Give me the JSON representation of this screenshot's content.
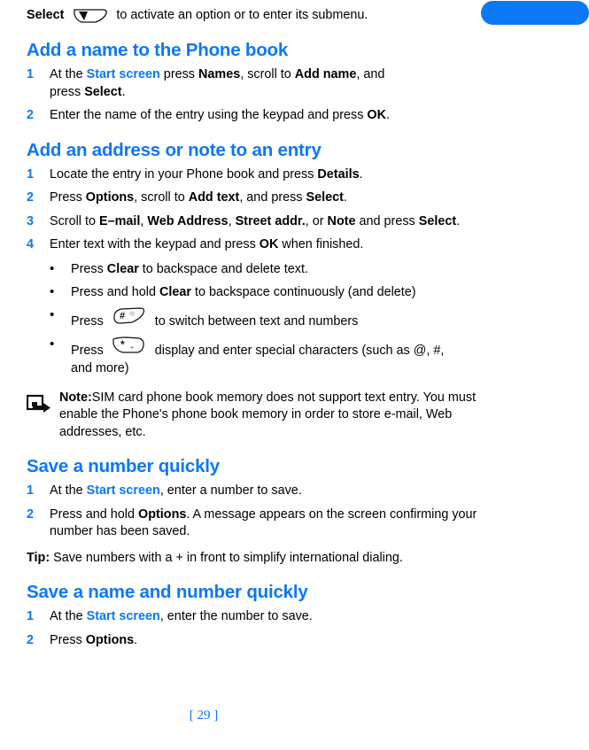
{
  "page": {
    "number_label": "[ 29 ]",
    "accent_color": "#0b78f5",
    "text_color": "#000000",
    "background_color": "#ffffff"
  },
  "tab_marker": {
    "name": "chapter-tab-marker",
    "color": "#0b78f5"
  },
  "intro": {
    "before_icon": "Select ",
    "icon": "select-soft-key-icon",
    "after_icon": " to activate an option or to enter its submenu."
  },
  "sections": [
    {
      "heading": "Add a name to the Phone book",
      "steps": [
        {
          "number": "1",
          "parts": [
            {
              "text": "At the ",
              "style": "normal"
            },
            {
              "text": "Start screen",
              "style": "bluebold"
            },
            {
              "text": " press ",
              "style": "normal"
            },
            {
              "text": "Names",
              "style": "bold"
            },
            {
              "text": ", scroll to ",
              "style": "normal"
            },
            {
              "text": "Add name",
              "style": "bold"
            },
            {
              "text": ", and",
              "style": "normal"
            },
            {
              "text": "BREAK",
              "style": "break"
            },
            {
              "text": "press ",
              "style": "normal"
            },
            {
              "text": "Select",
              "style": "bold"
            },
            {
              "text": ".",
              "style": "normal"
            }
          ]
        },
        {
          "number": "2",
          "parts": [
            {
              "text": "Enter the name of the entry using the keypad and press ",
              "style": "normal"
            },
            {
              "text": "OK",
              "style": "bold"
            },
            {
              "text": ".",
              "style": "normal"
            }
          ]
        }
      ]
    },
    {
      "heading": "Add an address or note to an entry",
      "steps": [
        {
          "number": "1",
          "parts": [
            {
              "text": "Locate the entry in your Phone book and press ",
              "style": "normal"
            },
            {
              "text": "Details",
              "style": "bold"
            },
            {
              "text": ".",
              "style": "normal"
            }
          ]
        },
        {
          "number": "2",
          "parts": [
            {
              "text": "Press ",
              "style": "normal"
            },
            {
              "text": "Options",
              "style": "bold"
            },
            {
              "text": ", scroll to ",
              "style": "normal"
            },
            {
              "text": "Add text",
              "style": "bold"
            },
            {
              "text": ", and press ",
              "style": "normal"
            },
            {
              "text": "Select",
              "style": "bold"
            },
            {
              "text": ".",
              "style": "normal"
            }
          ]
        },
        {
          "number": "3",
          "parts": [
            {
              "text": "Scroll to ",
              "style": "normal"
            },
            {
              "text": "E–mail",
              "style": "bold"
            },
            {
              "text": ", ",
              "style": "normal"
            },
            {
              "text": "Web Address",
              "style": "bold"
            },
            {
              "text": ", ",
              "style": "normal"
            },
            {
              "text": "Street addr.",
              "style": "bold"
            },
            {
              "text": ", or ",
              "style": "normal"
            },
            {
              "text": "Note",
              "style": "bold"
            },
            {
              "text": " and press ",
              "style": "normal"
            },
            {
              "text": "Select",
              "style": "bold"
            },
            {
              "text": ".",
              "style": "normal"
            }
          ]
        },
        {
          "number": "4",
          "parts": [
            {
              "text": "Enter text with the keypad and press ",
              "style": "normal"
            },
            {
              "text": "OK",
              "style": "bold"
            },
            {
              "text": " when finished.",
              "style": "normal"
            }
          ]
        }
      ],
      "bullets": [
        {
          "marker": "•",
          "parts": [
            {
              "text": "Press ",
              "style": "normal"
            },
            {
              "text": "Clear",
              "style": "bold"
            },
            {
              "text": " to backspace and delete text.",
              "style": "normal"
            }
          ]
        },
        {
          "marker": "•",
          "parts": [
            {
              "text": "Press and hold ",
              "style": "normal"
            },
            {
              "text": "Clear",
              "style": "bold"
            },
            {
              "text": " to backspace continuously (and delete)",
              "style": "normal"
            }
          ]
        },
        {
          "marker": "•",
          "parts": [
            {
              "text": "Press ",
              "style": "normal"
            },
            {
              "text": "hash-key-icon",
              "style": "icon-hash"
            },
            {
              "text": " to switch between text and numbers",
              "style": "normal"
            }
          ]
        },
        {
          "marker": "•",
          "parts": [
            {
              "text": "Press ",
              "style": "normal"
            },
            {
              "text": "star-key-icon",
              "style": "icon-star"
            },
            {
              "text": " display and enter special characters (such as @, #,",
              "style": "normal"
            },
            {
              "text": "BREAK",
              "style": "break"
            },
            {
              "text": "and more)",
              "style": "normal"
            }
          ]
        }
      ],
      "note": {
        "icon": "note-pointer-icon",
        "label": "Note:",
        "text": "SIM card phone book memory does not support text entry. You must enable the Phone's phone book memory in order to store e-mail, Web addresses, etc."
      }
    },
    {
      "heading": "Save a number quickly",
      "steps": [
        {
          "number": "1",
          "parts": [
            {
              "text": "At the ",
              "style": "normal"
            },
            {
              "text": "Start screen",
              "style": "bluebold"
            },
            {
              "text": ", enter a number to save.",
              "style": "normal"
            }
          ]
        },
        {
          "number": "2",
          "parts": [
            {
              "text": "Press and hold ",
              "style": "normal"
            },
            {
              "text": "Options",
              "style": "bold"
            },
            {
              "text": ". A message appears on the screen confirming your number has been saved.",
              "style": "normal"
            }
          ]
        }
      ],
      "tip": {
        "label": "Tip:",
        "text": "  Save numbers with a + in front to simplify international dialing."
      }
    },
    {
      "heading": "Save a name and number quickly",
      "steps": [
        {
          "number": "1",
          "parts": [
            {
              "text": "At the ",
              "style": "normal"
            },
            {
              "text": "Start screen",
              "style": "bluebold"
            },
            {
              "text": ", enter the number to save.",
              "style": "normal"
            }
          ]
        },
        {
          "number": "2",
          "parts": [
            {
              "text": "Press ",
              "style": "normal"
            },
            {
              "text": "Options",
              "style": "bold"
            },
            {
              "text": ".",
              "style": "normal"
            }
          ]
        }
      ]
    }
  ]
}
